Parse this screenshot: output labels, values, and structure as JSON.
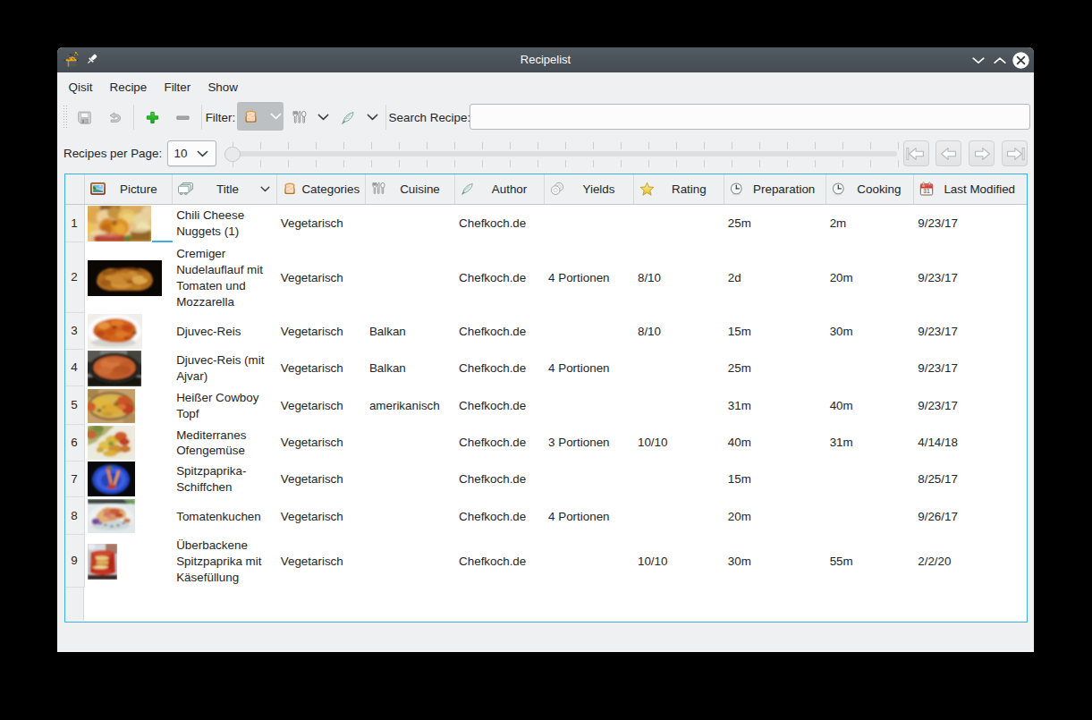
{
  "window": {
    "title": "Recipelist",
    "controls": {
      "minimize": "chevron-down",
      "maximize": "chevron-up",
      "close": "x-circle"
    }
  },
  "menu": {
    "items": [
      "Qisit",
      "Recipe",
      "Filter",
      "Show"
    ]
  },
  "toolbar": {
    "filter_label": "Filter:",
    "search_label": "Search Recipe:",
    "search_value": "",
    "buttons": [
      "save",
      "undo",
      "add",
      "remove"
    ],
    "filters": [
      "categories",
      "cuisine",
      "author"
    ]
  },
  "pager": {
    "label": "Recipes per Page:",
    "per_page": "10",
    "nav": [
      "first-page",
      "previous-page",
      "next-page",
      "last-page"
    ]
  },
  "table": {
    "columns": [
      {
        "label": "Picture",
        "icon": "picture-icon"
      },
      {
        "label": "Title",
        "icon": "title-cards-icon",
        "sort": "asc"
      },
      {
        "label": "Categories",
        "icon": "bread-icon"
      },
      {
        "label": "Cuisine",
        "icon": "cutlery-icon"
      },
      {
        "label": "Author",
        "icon": "feather-icon"
      },
      {
        "label": "Yields",
        "icon": "plates-icon"
      },
      {
        "label": "Rating",
        "icon": "star-icon"
      },
      {
        "label": "Preparation",
        "icon": "clock-icon"
      },
      {
        "label": "Cooking",
        "icon": "clock-icon"
      },
      {
        "label": "Last Modified",
        "icon": "calendar-icon"
      }
    ],
    "rows": [
      {
        "num": "1",
        "title": "Chili Cheese Nuggets (1)",
        "categories": "Vegetarisch",
        "cuisine": "",
        "author": "Chefkoch.de",
        "yields": "",
        "rating": "",
        "preparation": "25m",
        "cooking": "2m",
        "last_modified": "9/23/17",
        "image": {
          "name": "chili-cheese-nuggets-photo",
          "w": 71,
          "h": 40
        }
      },
      {
        "num": "2",
        "title": "Cremiger Nudelauflauf mit Tomaten und Mozzarella",
        "categories": "Vegetarisch",
        "cuisine": "",
        "author": "Chefkoch.de",
        "yields": "4 Portionen",
        "rating": "8/10",
        "preparation": "2d",
        "cooking": "20m",
        "last_modified": "9/23/17",
        "image": {
          "name": "cremiger-nudelauflauf-photo",
          "w": 83,
          "h": 40
        }
      },
      {
        "num": "3",
        "title": "Djuvec-Reis",
        "categories": "Vegetarisch",
        "cuisine": "Balkan",
        "author": "Chefkoch.de",
        "yields": "",
        "rating": "8/10",
        "preparation": "15m",
        "cooking": "30m",
        "last_modified": "9/23/17",
        "image": {
          "name": "djuvec-reis-photo",
          "w": 61,
          "h": 39
        }
      },
      {
        "num": "4",
        "title": "Djuvec-Reis (mit Ajvar)",
        "categories": "Vegetarisch",
        "cuisine": "Balkan",
        "author": "Chefkoch.de",
        "yields": "4 Portionen",
        "rating": "",
        "preparation": "25m",
        "cooking": "",
        "last_modified": "9/23/17",
        "image": {
          "name": "djuvec-reis-ajvar-photo",
          "w": 60,
          "h": 40
        }
      },
      {
        "num": "5",
        "title": "Heißer Cowboy Topf",
        "categories": "Vegetarisch",
        "cuisine": "amerikanisch",
        "author": "Chefkoch.de",
        "yields": "",
        "rating": "",
        "preparation": "31m",
        "cooking": "40m",
        "last_modified": "9/23/17",
        "image": {
          "name": "heisser-cowboy-topf-photo",
          "w": 53,
          "h": 38
        }
      },
      {
        "num": "6",
        "title": "Mediterranes Ofengemüse",
        "categories": "Vegetarisch",
        "cuisine": "",
        "author": "Chefkoch.de",
        "yields": "3 Portionen",
        "rating": "10/10",
        "preparation": "40m",
        "cooking": "31m",
        "last_modified": "4/14/18",
        "image": {
          "name": "mediterranes-ofengemuese-photo",
          "w": 53,
          "h": 38
        }
      },
      {
        "num": "7",
        "title": "Spitzpaprika-Schiffchen",
        "categories": "Vegetarisch",
        "cuisine": "",
        "author": "Chefkoch.de",
        "yields": "",
        "rating": "",
        "preparation": "15m",
        "cooking": "",
        "last_modified": "8/25/17",
        "image": {
          "name": "spitzpaprika-schiffchen-photo",
          "w": 53,
          "h": 39
        }
      },
      {
        "num": "8",
        "title": "Tomatenkuchen",
        "categories": "Vegetarisch",
        "cuisine": "",
        "author": "Chefkoch.de",
        "yields": "4 Portionen",
        "rating": "",
        "preparation": "20m",
        "cooking": "",
        "last_modified": "9/26/17",
        "image": {
          "name": "tomatenkuchen-photo",
          "w": 53,
          "h": 38
        }
      },
      {
        "num": "9",
        "title": "Überbackene Spitzpaprika mit Käsefüllung",
        "categories": "Vegetarisch",
        "cuisine": "",
        "author": "Chefkoch.de",
        "yields": "",
        "rating": "10/10",
        "preparation": "30m",
        "cooking": "55m",
        "last_modified": "2/2/20",
        "image": {
          "name": "ueberbackene-spitzpaprika-photo",
          "w": 33,
          "h": 40
        }
      }
    ]
  },
  "colors": {
    "accent": "#3daee9",
    "titlebar_top": "#525a62",
    "titlebar_bottom": "#454c53",
    "window_bg": "#eff0f1",
    "text": "#232629"
  }
}
